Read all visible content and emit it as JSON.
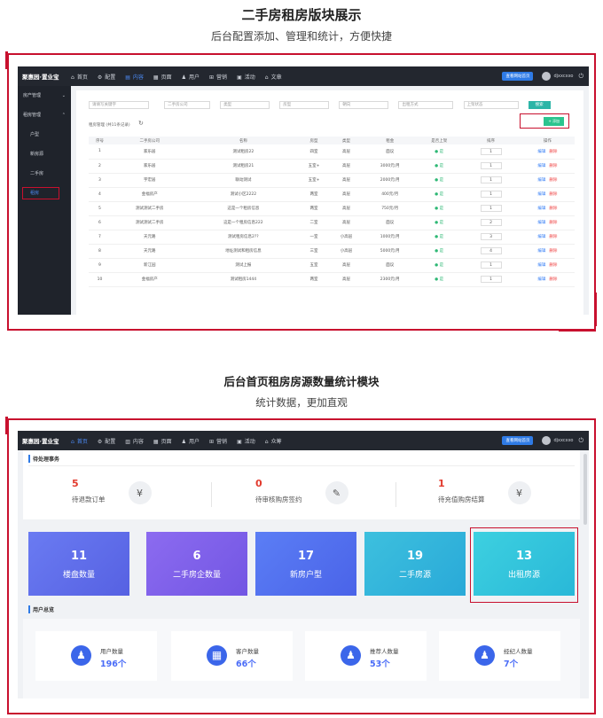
{
  "section1": {
    "title": "二手房租房版块展示",
    "subtitle": "后台配置添加、管理和统计，方便快捷"
  },
  "section2": {
    "title": "后台首页租房房源数量统计模块",
    "subtitle": "统计数据，更加直观"
  },
  "app": {
    "brand": "聚惠园·置业宝",
    "topbar_button": "查看网站首页",
    "username": "djxxcxxo"
  },
  "nav1": [
    {
      "label": "首页",
      "icon": "⌂"
    },
    {
      "label": "配置",
      "icon": "⚙"
    },
    {
      "label": "内容",
      "icon": "▤"
    },
    {
      "label": "页面",
      "icon": "▦"
    },
    {
      "label": "用户",
      "icon": "♟"
    },
    {
      "label": "营销",
      "icon": "⊞"
    },
    {
      "label": "活动",
      "icon": "▣"
    },
    {
      "label": "文章",
      "icon": "⌂"
    }
  ],
  "nav2": [
    {
      "label": "首页",
      "icon": "⌂"
    },
    {
      "label": "配置",
      "icon": "⚙"
    },
    {
      "label": "内容",
      "icon": "▥"
    },
    {
      "label": "页面",
      "icon": "▦"
    },
    {
      "label": "用户",
      "icon": "♟"
    },
    {
      "label": "营销",
      "icon": "⊞"
    },
    {
      "label": "活动",
      "icon": "▣"
    },
    {
      "label": "众筹",
      "icon": "⌂"
    }
  ],
  "sidebar": {
    "group1": "房产管理",
    "group2": "租房管理",
    "items": [
      "户型",
      "新房源",
      "二手房",
      "租房"
    ]
  },
  "filters": {
    "search_placeholder": "请填写关键字",
    "selects": [
      "二手房公司",
      "类型",
      "房型",
      "朝向",
      "出租方式",
      "上架状态"
    ],
    "search_button": "搜索"
  },
  "list": {
    "title": "租房管理 (共11条记录)",
    "add_button": "+ 添加"
  },
  "table": {
    "headers": [
      "序号",
      "二手房公司",
      "名称",
      "房型",
      "类型",
      "租金",
      "是否上架",
      "排序",
      "操作"
    ],
    "rows": [
      [
        "1",
        "家乐居",
        "测试租房22",
        "四室",
        "高层",
        "面议",
        "是",
        "1"
      ],
      [
        "2",
        "家乐居",
        "测试租房21",
        "五室+",
        "高层",
        "3000元/月",
        "是",
        "1"
      ],
      [
        "3",
        "宇宏居",
        "联动测试",
        "五室+",
        "高层",
        "2000元/月",
        "是",
        "1"
      ],
      [
        "4",
        "金福房产",
        "测试小区2222",
        "两室",
        "高层",
        "400元/月",
        "是",
        "1"
      ],
      [
        "5",
        "测试测试二手房",
        "这是一个租房信息",
        "两室",
        "高层",
        "750元/月",
        "是",
        "1"
      ],
      [
        "6",
        "测试测试二手房",
        "这是一个租房信息222",
        "二室",
        "高层",
        "面议",
        "是",
        "2"
      ],
      [
        "7",
        "天元路",
        "测试租房信息2??",
        "一室",
        "小高层",
        "1000元/月",
        "是",
        "3"
      ],
      [
        "8",
        "天元路",
        "地址测试和租房信息",
        "三室",
        "小高层",
        "5000元/月",
        "是",
        "4"
      ],
      [
        "9",
        "新江园",
        "测试上报",
        "五室",
        "高层",
        "面议",
        "是",
        "1"
      ],
      [
        "10",
        "金福房产",
        "测试租房1444",
        "两室",
        "高层",
        "2300元/月",
        "是",
        "1"
      ]
    ],
    "edit": "编辑",
    "delete": "删除"
  },
  "dashboard": {
    "pending_title": "待处理事务",
    "todos": [
      {
        "value": "5",
        "label": "待退款订单",
        "icon": "¥"
      },
      {
        "value": "0",
        "label": "待审核购房签约",
        "icon": "✎"
      },
      {
        "value": "1",
        "label": "待充值购房结算",
        "icon": "¥"
      }
    ],
    "cards": [
      {
        "value": "11",
        "label": "楼盘数量",
        "color1": "#6a7bf2",
        "color2": "#5661e2"
      },
      {
        "value": "6",
        "label": "二手房企数量",
        "color1": "#8c6bf0",
        "color2": "#7256e3"
      },
      {
        "value": "17",
        "label": "新房户型",
        "color1": "#5b7ef5",
        "color2": "#4a63e8"
      },
      {
        "value": "19",
        "label": "二手房源",
        "color1": "#3dc0de",
        "color2": "#29a9d8"
      },
      {
        "value": "13",
        "label": "出租房源",
        "color1": "#3dd0e0",
        "color2": "#29b8d8"
      }
    ],
    "overview_title": "用户总览",
    "overview": [
      {
        "label": "用户数量",
        "value": "196个",
        "icon": "♟"
      },
      {
        "label": "客户数量",
        "value": "66个",
        "icon": "▦"
      },
      {
        "label": "推荐人数量",
        "value": "53个",
        "icon": "♟"
      },
      {
        "label": "经纪人数量",
        "value": "7个",
        "icon": "♟"
      }
    ]
  },
  "colors": {
    "accent": "#c8102e",
    "primary": "#2f7be6",
    "dark": "#23272f"
  }
}
